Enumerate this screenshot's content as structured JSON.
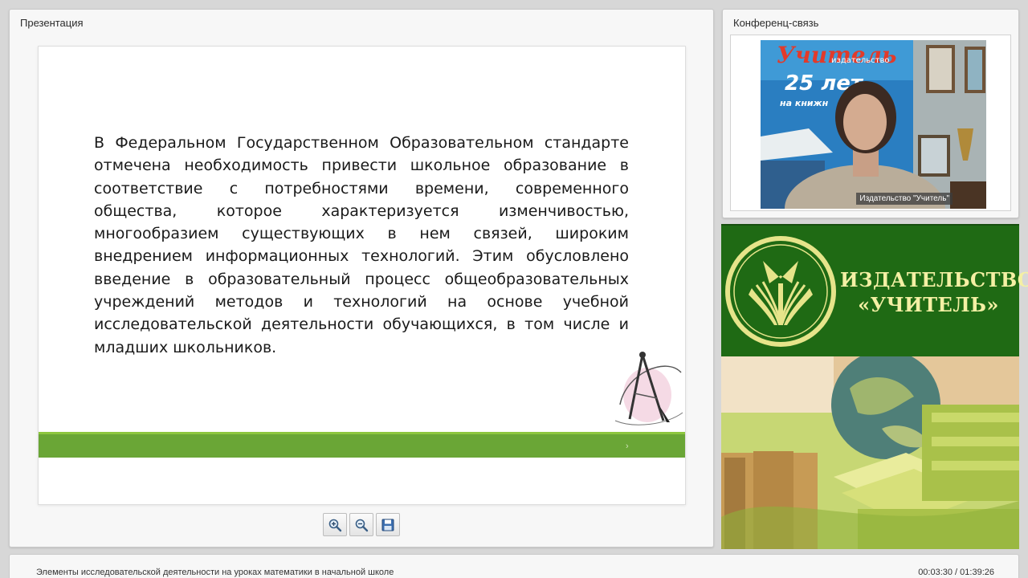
{
  "presentation": {
    "title": "Презентация",
    "slide_text": "В Федеральном Государственном Образовательном стандарте отмечена необходимость привести школьное образование в соответствие с потребностями времени, современного общества, которое характеризуется изменчивостью, многообразием существующих в нем связей, широким внедрением информационных технологий. Этим обусловлено введение в образовательный процесс общеобразовательных учреждений методов и технологий на основе учебной исследовательской деятельности обучающихся, в том числе и младших школьников.",
    "slide_nav_arrow": "›",
    "toolbar": [
      {
        "icon": "zoom-in-icon"
      },
      {
        "icon": "zoom-out-icon"
      },
      {
        "icon": "save-icon"
      }
    ]
  },
  "conference": {
    "title": "Конференц-связь",
    "video_caption": "Издательство \"Учитель\"",
    "banner_brand": "Учитель",
    "banner_sub": "издательство",
    "banner_years": "25 лет",
    "banner_books": "на книжн"
  },
  "logo": {
    "line1": "ИЗДАТЕЛЬСТВО",
    "line2": "«УЧИТЕЛЬ»"
  },
  "footer": {
    "lecture_title": "Элементы исследовательской деятельности на уроках математики в начальной школе",
    "time": "00:03:30 / 01:39:26"
  },
  "colors": {
    "slide_band": "#6aa636",
    "logo_bg": "#1f6a14",
    "logo_text": "#f4f0a4"
  }
}
